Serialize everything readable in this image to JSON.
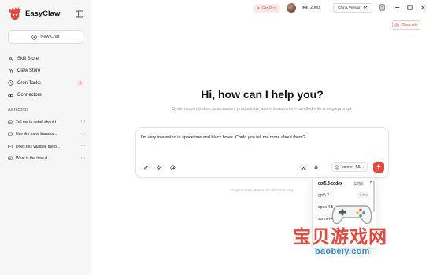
{
  "app": {
    "name": "EasyClaw"
  },
  "sidebar": {
    "new_chat_label": "New Chat",
    "nav": [
      {
        "label": "Skill Store",
        "icon": "skill-icon"
      },
      {
        "label": "Claw Store",
        "icon": "claw-icon"
      },
      {
        "label": "Cron Tasks",
        "icon": "clock-icon",
        "badge": "1"
      },
      {
        "label": "Connectors",
        "icon": "connector-icon"
      }
    ],
    "records_title": "All records",
    "records": [
      {
        "title": "Tell me in detail about t..."
      },
      {
        "title": "Use the nano-banana..."
      },
      {
        "title": "Does this validate the p..."
      },
      {
        "title": "What is the time d..."
      }
    ]
  },
  "topbar": {
    "get_plus": "Get Plus",
    "credits": "2000",
    "china_version": "China Version",
    "channels": "Channels"
  },
  "main": {
    "greeting": "Hi, how can I help you?",
    "subtitle": "System optimization, automation, productivity, and entertainment-handled with a singleprompt.",
    "composer_text": "I'm very interested in spacetime and black holes. Could you tell me more about them?",
    "model": "sonnet-4.5",
    "disclaimer": "AI-generated content, for reference only"
  },
  "model_menu": [
    {
      "name": "gpt5.3-codex",
      "multiplier": "1.75x",
      "selected": true
    },
    {
      "name": "gpt5.2",
      "multiplier": "1.75x",
      "selected": false
    },
    {
      "name": "opus-4.5",
      "multiplier": "5x",
      "selected": false
    },
    {
      "name": "sonnet-4",
      "multiplier": "3x",
      "selected": false
    }
  ],
  "watermark": {
    "text": "宝贝游戏网",
    "url": "baobeiy.com"
  },
  "colors": {
    "accent": "#e5483c",
    "sidebar_bg": "#f6f6f7",
    "watermark_blue": "#2e8fd8"
  }
}
